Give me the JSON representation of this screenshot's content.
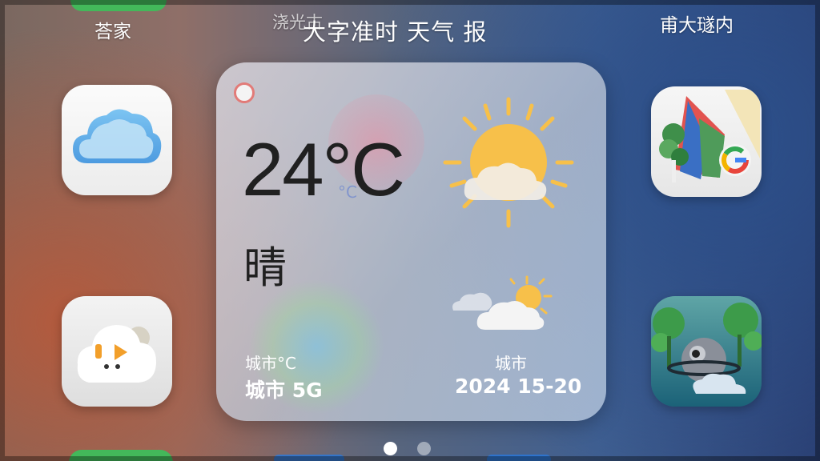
{
  "header": {
    "left_label": "荅家",
    "center_ghost_label": "浇光古",
    "title": "大字准时 天气 报",
    "right_label": "甫大璲内"
  },
  "widget": {
    "temperature": "24°C",
    "temperature_ghost": "°C",
    "condition": "晴",
    "left_line1": "城市°C",
    "left_line2": "城市 5G",
    "right_line1": "城市",
    "right_line2": "2024 15-20"
  },
  "icons": {
    "left_top": "cloud-app-icon",
    "right_top": "map-app-icon",
    "left_bottom": "chat-cloud-app-icon",
    "right_bottom": "game-app-icon",
    "weather_main": "sun-cloud-icon",
    "weather_forecast": "partly-cloudy-icon"
  },
  "pagination": {
    "total": 2,
    "active": 1
  },
  "colors": {
    "accent_blue": "#4d9be0",
    "sun_yellow": "#f7c04a",
    "indicator_red": "#e27b78"
  }
}
